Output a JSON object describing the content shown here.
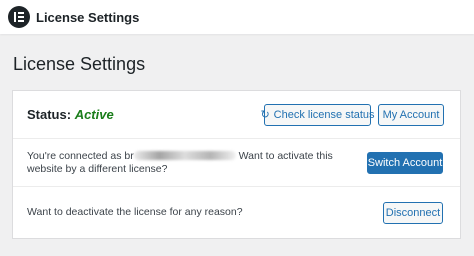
{
  "header": {
    "app_title": "License Settings",
    "logo_icon": "elementor-logo"
  },
  "page": {
    "title": "License Settings"
  },
  "status_row": {
    "status_label": "Status:",
    "status_value": "Active",
    "check_button_icon": "refresh-icon",
    "check_button_label": "Check license status",
    "account_button_label": "My Account"
  },
  "connected_row": {
    "text_before": "You're connected as br",
    "text_after": " Want to activate this website by a different license?",
    "switch_button_label": "Switch Account"
  },
  "deactivate_row": {
    "text": "Want to deactivate the license for any reason?",
    "disconnect_button_label": "Disconnect"
  },
  "colors": {
    "background": "#f0f0f1",
    "accent": "#2271b1",
    "status_active": "#1a7d1a"
  }
}
